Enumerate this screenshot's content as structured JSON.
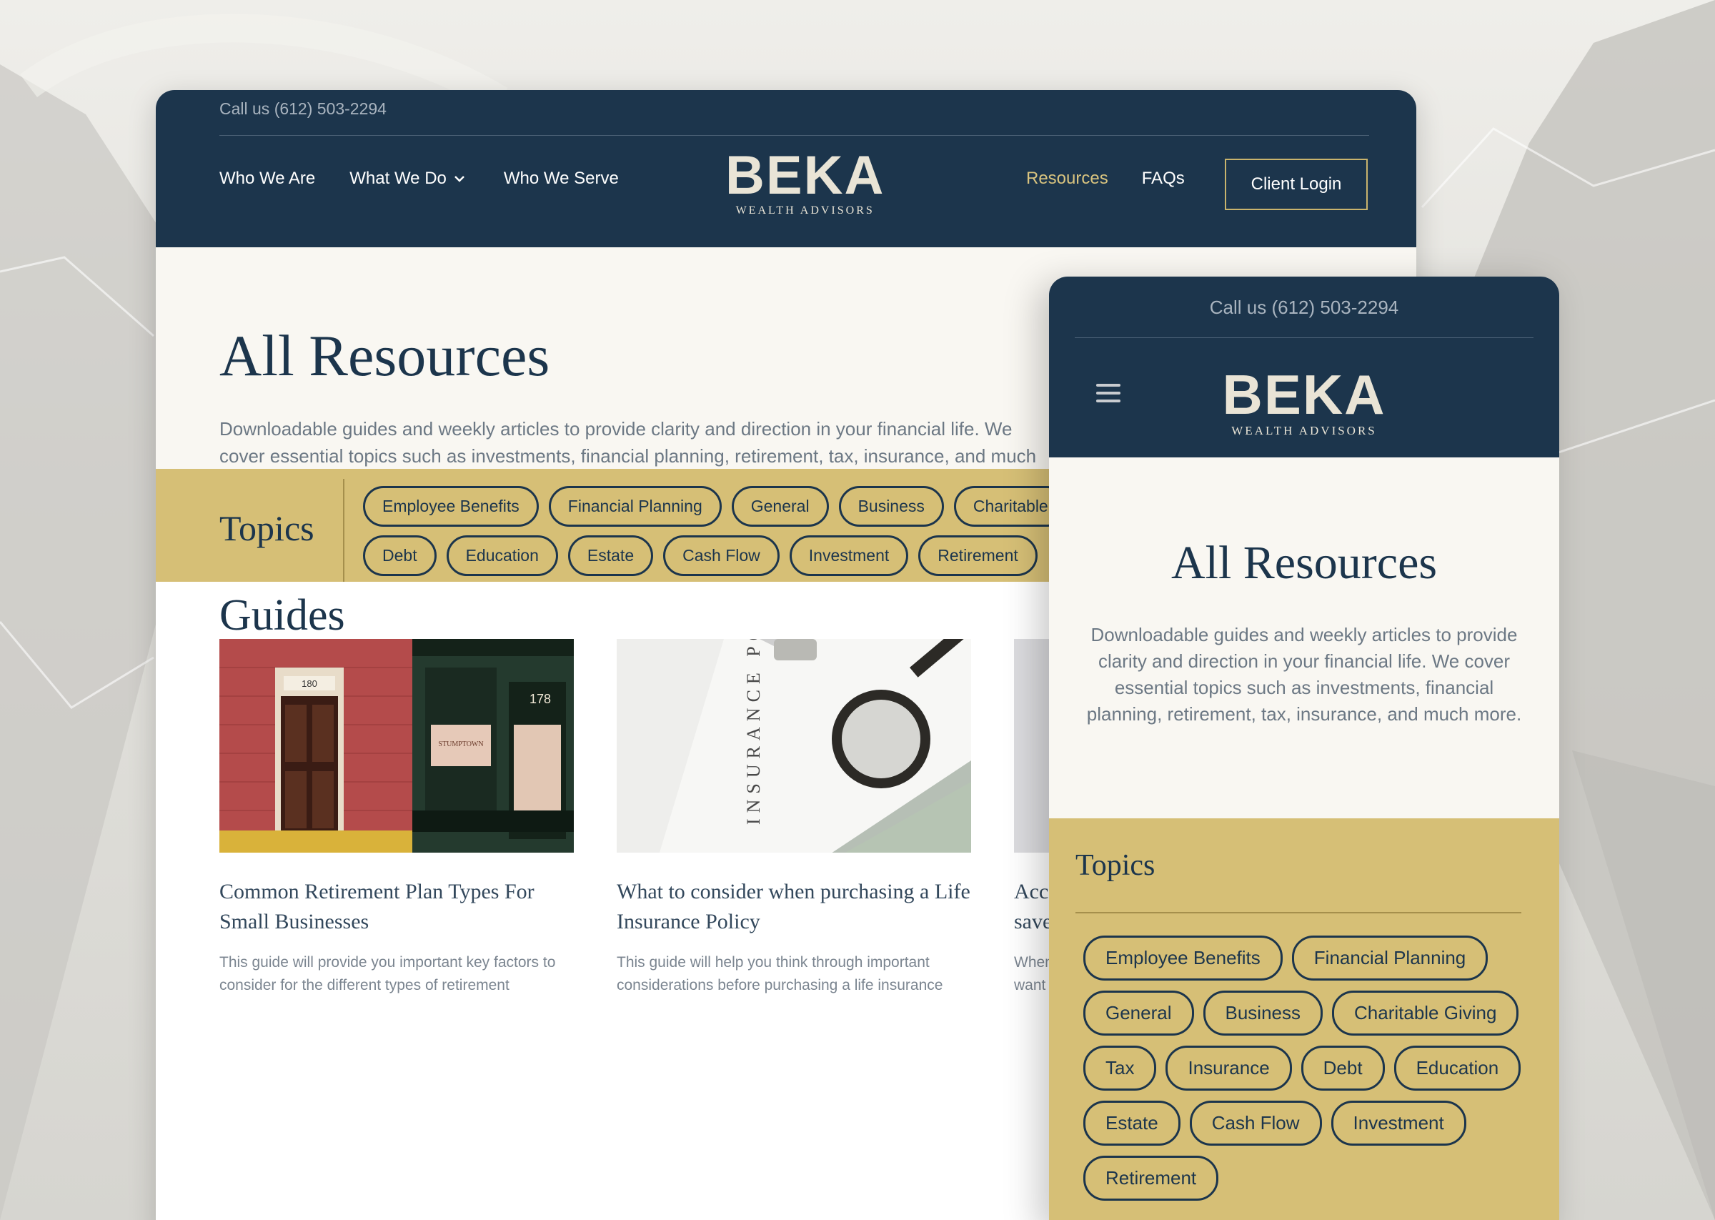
{
  "desktop": {
    "phone_text": "Call us (612) 503-2294",
    "nav_left": [
      "Who We Are",
      "What We Do",
      "Who We Serve"
    ],
    "nav_right": [
      "Resources",
      "FAQs"
    ],
    "login_label": "Client Login",
    "logo": {
      "mark": "BEKA",
      "sub": "WEALTH ADVISORS"
    },
    "hero": {
      "title": "All Resources",
      "description": "Downloadable guides and weekly articles to provide clarity and direction in your financial life. We cover essential topics such as investments, financial planning, retirement, tax, insurance, and much more."
    },
    "topics": {
      "label": "Topics",
      "row1": [
        "Employee Benefits",
        "Financial Planning",
        "General",
        "Business",
        "Charitable"
      ],
      "row2": [
        "Debt",
        "Education",
        "Estate",
        "Cash Flow",
        "Investment",
        "Retirement"
      ]
    },
    "guides": {
      "heading": "Guides",
      "cards": [
        {
          "title": "Common Retirement Plan Types For Small Businesses",
          "text": "This guide will provide you important key factors to consider for the different types of retirement"
        },
        {
          "title": "What to consider when purchasing a Life Insurance Policy",
          "text": "This guide will help you think through important considerations before purchasing a life insurance"
        },
        {
          "title": "Acc save",
          "text": "When want"
        }
      ],
      "image_text": {
        "door_number": "180",
        "shop_number": "178",
        "shop_sign": "STUMPTOWN",
        "policy_text": "INSURANCE POLICY"
      }
    }
  },
  "mobile": {
    "phone_text": "Call us (612) 503-2294",
    "logo": {
      "mark": "BEKA",
      "sub": "WEALTH ADVISORS"
    },
    "hero": {
      "title": "All Resources",
      "description": "Downloadable guides and weekly articles to provide clarity and direction in your financial life. We cover essential topics such as investments, financial planning, retirement, tax, insurance, and much more."
    },
    "topics": {
      "label": "Topics",
      "rows": [
        [
          "Employee Benefits",
          "Financial Planning"
        ],
        [
          "General",
          "Business",
          "Charitable Giving"
        ],
        [
          "Tax",
          "Insurance",
          "Debt",
          "Education"
        ],
        [
          "Estate",
          "Cash Flow",
          "Investment"
        ],
        [
          "Retirement"
        ]
      ]
    }
  },
  "colors": {
    "navy": "#1c354c",
    "gold": "#d6bf76",
    "cream": "#f9f7f2",
    "active_link": "#d9c47f"
  },
  "icons": [
    "chevron-down-icon",
    "hamburger-menu-icon"
  ]
}
